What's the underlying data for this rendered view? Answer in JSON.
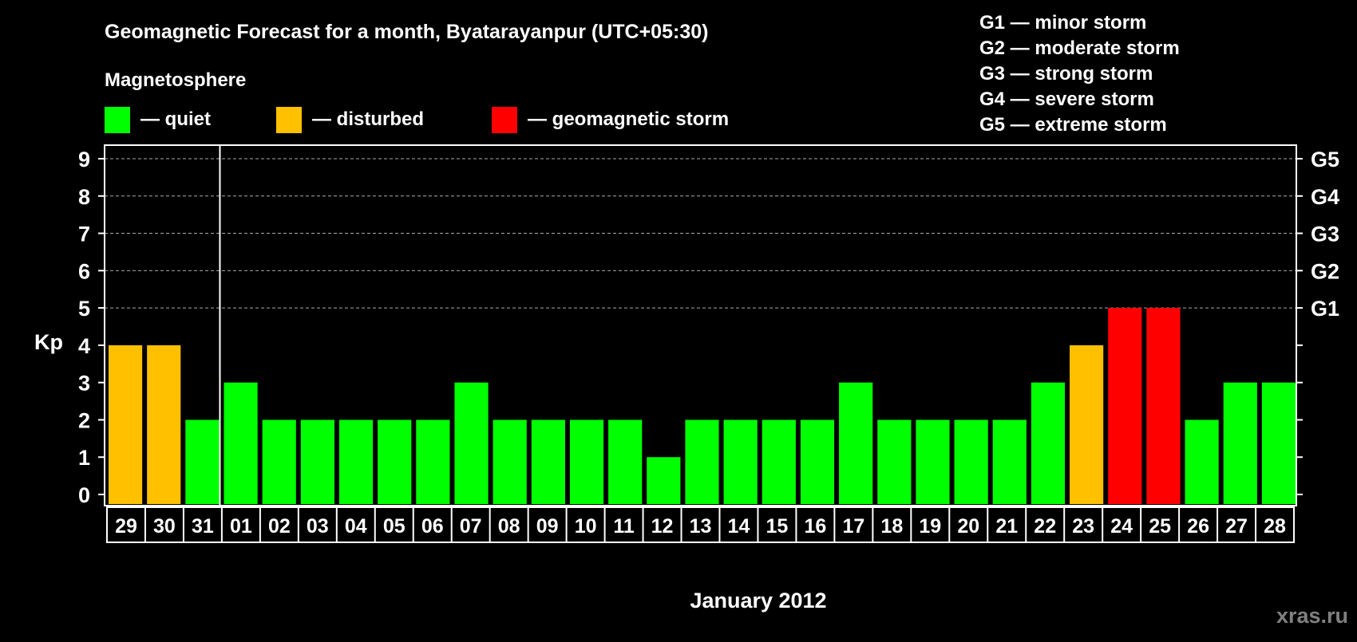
{
  "chart_data": {
    "type": "bar",
    "title": "Geomagnetic Forecast for a month, Byatarayanpur (UTC+05:30)",
    "legend_title": "Magnetosphere",
    "legend": [
      {
        "label": "— quiet",
        "color": "#00ff00"
      },
      {
        "label": "— disturbed",
        "color": "#ffc000"
      },
      {
        "label": "— geomagnetic storm",
        "color": "#ff0000"
      }
    ],
    "scale_legend": [
      "G1 — minor storm",
      "G2 — moderate storm",
      "G3 — strong storm",
      "G4 — severe storm",
      "G5 — extreme storm"
    ],
    "ylabel": "Kp",
    "xlabel": "January 2012",
    "ylim": [
      0,
      9
    ],
    "yticks": [
      "0",
      "1",
      "2",
      "3",
      "4",
      "5",
      "6",
      "7",
      "8",
      "9"
    ],
    "right_ticks": [
      {
        "kp": 5,
        "label": "G1"
      },
      {
        "kp": 6,
        "label": "G2"
      },
      {
        "kp": 7,
        "label": "G3"
      },
      {
        "kp": 8,
        "label": "G4"
      },
      {
        "kp": 9,
        "label": "G5"
      }
    ],
    "grid": "dashed lines at Kp 5–9",
    "categories": [
      "29",
      "30",
      "31",
      "01",
      "02",
      "03",
      "04",
      "05",
      "06",
      "07",
      "08",
      "09",
      "10",
      "11",
      "12",
      "13",
      "14",
      "15",
      "16",
      "17",
      "18",
      "19",
      "20",
      "21",
      "22",
      "23",
      "24",
      "25",
      "26",
      "27",
      "28"
    ],
    "values": [
      4,
      4,
      2,
      3,
      2,
      2,
      2,
      2,
      2,
      3,
      2,
      2,
      2,
      2,
      1,
      2,
      2,
      2,
      2,
      3,
      2,
      2,
      2,
      2,
      3,
      4,
      5,
      5,
      2,
      3,
      3
    ],
    "month_divider_after": "31"
  },
  "watermark": "xras.ru"
}
